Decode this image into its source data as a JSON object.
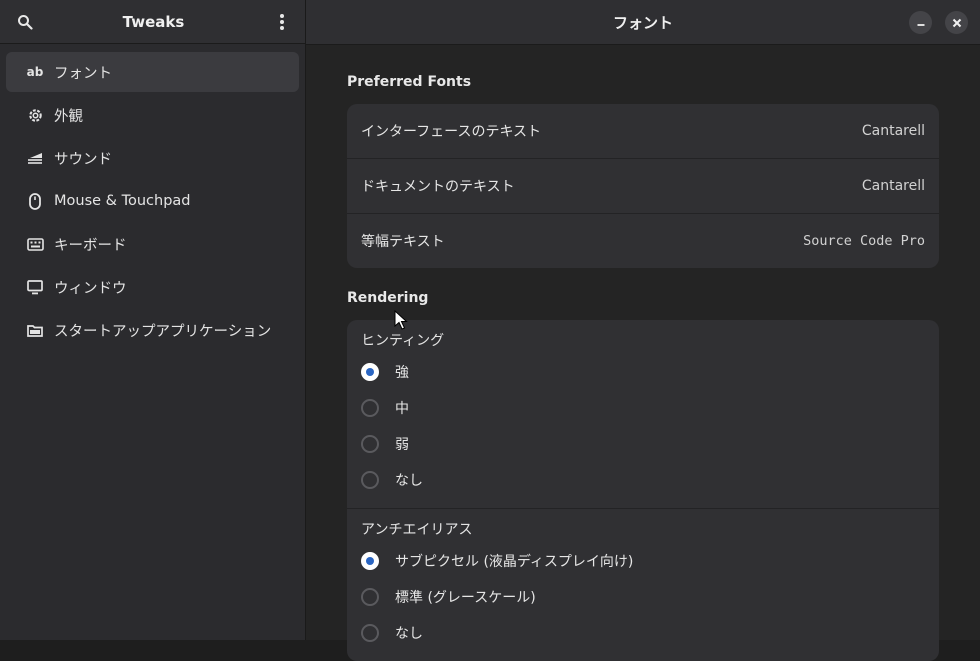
{
  "sidebar": {
    "title": "Tweaks",
    "items": [
      {
        "label": "フォント",
        "icon": "ab"
      },
      {
        "label": "外観",
        "icon": "gear-icon"
      },
      {
        "label": "サウンド",
        "icon": "sound-icon"
      },
      {
        "label": "Mouse & Touchpad",
        "icon": "mouse-icon"
      },
      {
        "label": "キーボード",
        "icon": "keyboard-icon"
      },
      {
        "label": "ウィンドウ",
        "icon": "monitor-icon"
      },
      {
        "label": "スタートアップアプリケーション",
        "icon": "folder-icon"
      }
    ],
    "active_index": 0
  },
  "header": {
    "title": "フォント"
  },
  "preferred_fonts": {
    "title": "Preferred Fonts",
    "rows": [
      {
        "label": "インターフェースのテキスト",
        "value": "Cantarell"
      },
      {
        "label": "ドキュメントのテキスト",
        "value": "Cantarell"
      },
      {
        "label": "等幅テキスト",
        "value": "Source Code Pro"
      }
    ]
  },
  "rendering": {
    "title": "Rendering",
    "hinting": {
      "label": "ヒンティング",
      "options": [
        "強",
        "中",
        "弱",
        "なし"
      ],
      "selected": 0
    },
    "antialiasing": {
      "label": "アンチエイリアス",
      "options": [
        "サブピクセル (液晶ディスプレイ向け)",
        "標準 (グレースケール)",
        "なし"
      ],
      "selected": 0
    }
  },
  "colors": {
    "accent": "#2a65c2"
  }
}
